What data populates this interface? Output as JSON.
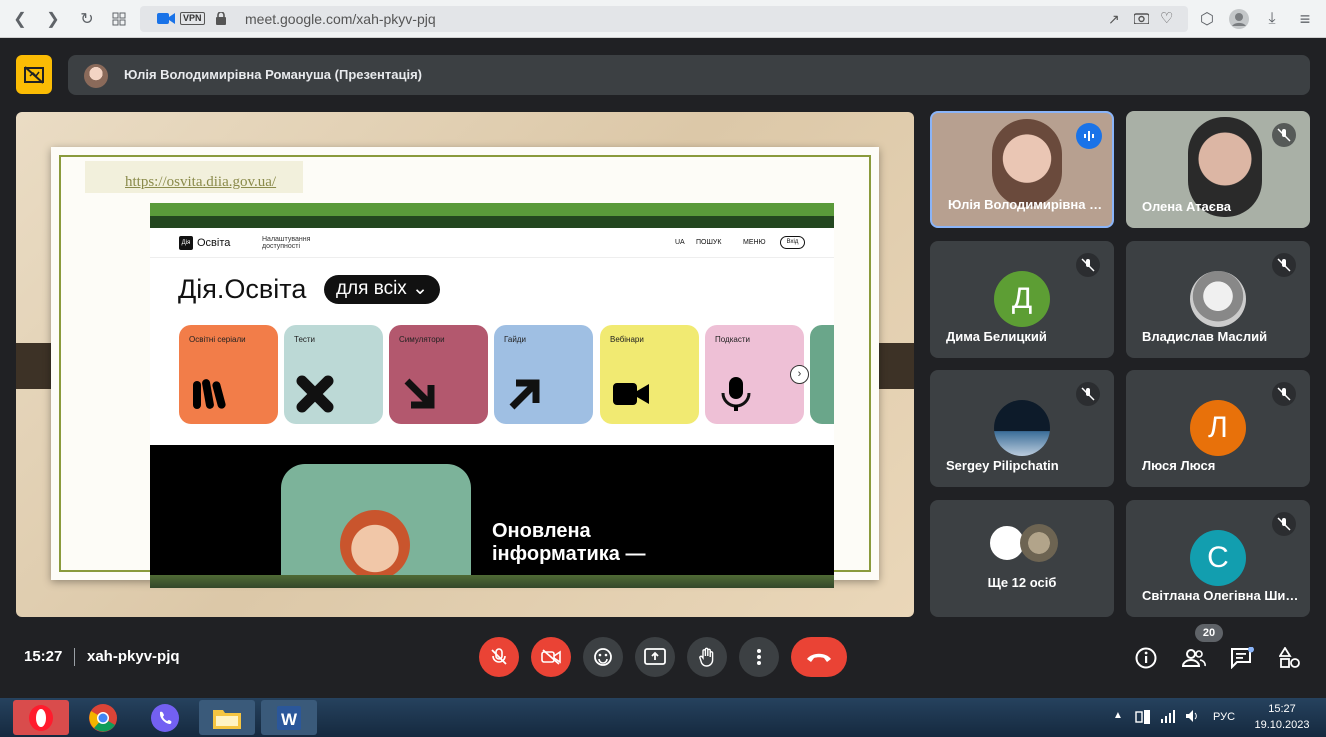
{
  "browser": {
    "vpn_label": "VPN",
    "url": "meet.google.com/xah-pkyv-pjq"
  },
  "presenter": {
    "title": "Юлія Володимирівна Романуша (Презентація)"
  },
  "slide": {
    "link": "https://osvita.diia.gov.ua/",
    "site": {
      "logo_mark": "Дія",
      "logo_text": "Освіта",
      "accessibility": [
        "Налаштування",
        "доступності"
      ],
      "nav_lang": "UA",
      "nav_search": "ПОШУК",
      "nav_menu": "МЕНЮ",
      "nav_login": "Вхід",
      "headline": "Дія.Освіта",
      "pill": "для всіх",
      "cards": [
        {
          "label": "Освітні серіали",
          "color": "#f27d49"
        },
        {
          "label": "Тести",
          "color": "#bcd9d6"
        },
        {
          "label": "Симулятори",
          "color": "#b3586e"
        },
        {
          "label": "Гайди",
          "color": "#9fbfe3"
        },
        {
          "label": "Вебінари",
          "color": "#f1ea72"
        },
        {
          "label": "Подкасти",
          "color": "#eec0d6"
        }
      ],
      "banner_line1": "Оновлена",
      "banner_line2": "інформатика —"
    }
  },
  "participants": [
    {
      "name": "Юлія Володимирівна Романуша",
      "type": "video",
      "speaking": true
    },
    {
      "name": "Олена Атаєва",
      "type": "video",
      "muted": true
    },
    {
      "name": "Дима Белицкий",
      "initial": "Д",
      "color": "#5d9e34",
      "muted": true
    },
    {
      "name": "Владислав Маслий",
      "type": "photo",
      "muted": true
    },
    {
      "name": "Sergey Pilipchatin",
      "type": "photo",
      "muted": true
    },
    {
      "name": "Люся Люся",
      "initial": "Л",
      "color": "#e8710a",
      "muted": true
    },
    {
      "name": "Ще 12 осіб",
      "type": "more"
    },
    {
      "name": "Світлана Олегівна Ширшова",
      "initial": "С",
      "color": "#129eaf",
      "muted": true
    }
  ],
  "bottom": {
    "time": "15:27",
    "meeting_code": "xah-pkyv-pjq",
    "participant_count": "20"
  },
  "taskbar": {
    "lang": "РУС",
    "time": "15:27",
    "date": "19.10.2023"
  }
}
